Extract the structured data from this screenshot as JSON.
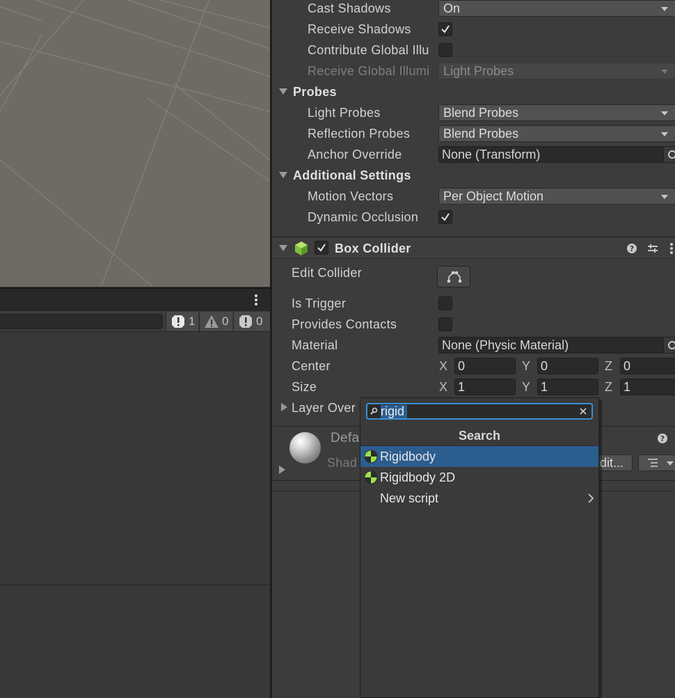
{
  "inspector": {
    "mesh_renderer": {
      "cast_shadows": {
        "label": "Cast Shadows",
        "value": "On"
      },
      "receive_shadows": {
        "label": "Receive Shadows",
        "checked": true
      },
      "contribute_gi": {
        "label": "Contribute Global Illu",
        "checked": false
      },
      "receive_gi": {
        "label": "Receive Global Illumi",
        "value": "Light Probes"
      },
      "probes": {
        "header": "Probes",
        "light_probes": {
          "label": "Light Probes",
          "value": "Blend Probes"
        },
        "reflection_probes": {
          "label": "Reflection Probes",
          "value": "Blend Probes"
        },
        "anchor_override": {
          "label": "Anchor Override",
          "value": "None (Transform)"
        }
      },
      "additional": {
        "header": "Additional Settings",
        "motion_vectors": {
          "label": "Motion Vectors",
          "value": "Per Object Motion"
        },
        "dynamic_occlusion": {
          "label": "Dynamic Occlusion",
          "checked": true
        }
      }
    },
    "box_collider": {
      "title": "Box Collider",
      "enabled": true,
      "edit_collider": {
        "label": "Edit Collider"
      },
      "is_trigger": {
        "label": "Is Trigger",
        "checked": false
      },
      "provides_contacts": {
        "label": "Provides Contacts",
        "checked": false
      },
      "material": {
        "label": "Material",
        "value": "None (Physic Material)"
      },
      "center": {
        "label": "Center",
        "x_label": "X",
        "y_label": "Y",
        "z_label": "Z",
        "x": "0",
        "y": "0",
        "z": "0"
      },
      "size": {
        "label": "Size",
        "x_label": "X",
        "y_label": "Y",
        "z_label": "Z",
        "x": "1",
        "y": "1",
        "z": "1"
      },
      "layer_overrides": {
        "label": "Layer Over"
      }
    },
    "material_preview": {
      "name": "Defa",
      "shader_label": "Shad",
      "edit_button": "dit..."
    }
  },
  "console": {
    "counts": {
      "errors": "1",
      "warnings": "0",
      "messages": "0"
    }
  },
  "add_component_popup": {
    "search_value": "rigid",
    "title": "Search",
    "items": [
      {
        "label": "Rigidbody",
        "icon": "rigidbody-icon",
        "selected": true
      },
      {
        "label": "Rigidbody 2D",
        "icon": "rigidbody-icon",
        "selected": false
      },
      {
        "label": "New script",
        "icon": "",
        "submenu": true
      }
    ]
  },
  "colors": {
    "selection": "#2c5d8f",
    "focus_border": "#3d8fd6",
    "rigidbody_icon": "#9be34a",
    "scene_ground": "#6f6a63"
  }
}
